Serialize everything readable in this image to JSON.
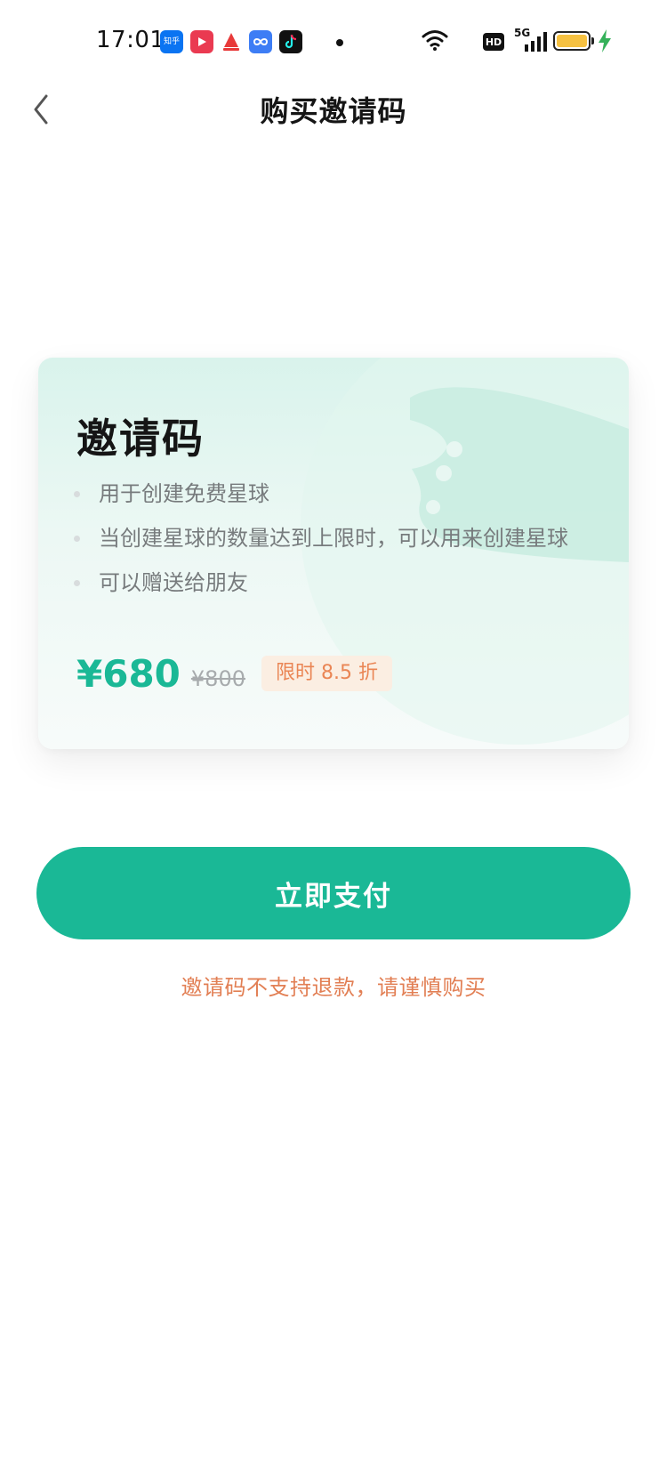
{
  "status_bar": {
    "time": "17:01",
    "app_icons": [
      {
        "name": "zhihu-icon",
        "label": "知乎",
        "color": "#0a74f2"
      },
      {
        "name": "video-play-icon",
        "label": "",
        "color": "#ea3a51"
      },
      {
        "name": "sail-icon",
        "label": "",
        "color": "#ffffff"
      },
      {
        "name": "infinity-icon",
        "label": "",
        "color": "#3d7df5"
      },
      {
        "name": "tiktok-icon",
        "label": "",
        "color": "#111111"
      }
    ],
    "hd_label": "HD",
    "network_label": "5G",
    "battery_color": "#f6c141",
    "charging_color": "#35b15a"
  },
  "nav": {
    "back_icon": "chevron-left-icon",
    "title": "购买邀请码"
  },
  "card": {
    "title": "邀请码",
    "features": [
      "用于创建免费星球",
      "当创建星球的数量达到上限时，可以用来创建星球",
      "可以赠送给朋友"
    ],
    "price": "¥680",
    "original_price": "¥800",
    "discount": "限时 8.5 折",
    "accent_color": "#1ab896"
  },
  "pay_button": {
    "label": "立即支付"
  },
  "refund_note": "邀请码不支持退款，请谨慎购买"
}
